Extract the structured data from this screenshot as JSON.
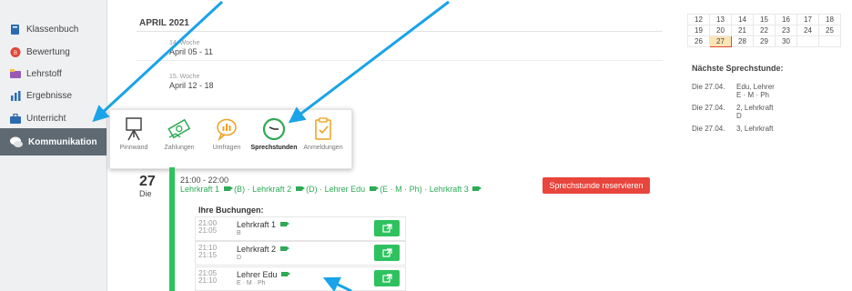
{
  "sidebar": {
    "items": [
      {
        "label": "Klassenbuch",
        "icon": "book-icon",
        "color": "#2b6cb0"
      },
      {
        "label": "Bewertung",
        "icon": "badge-icon",
        "color": "#e0453a"
      },
      {
        "label": "Lehrstoff",
        "icon": "folder-icon",
        "color": "#9b59b6"
      },
      {
        "label": "Ergebnisse",
        "icon": "bar-chart-icon",
        "color": "#2b6cb0"
      },
      {
        "label": "Unterricht",
        "icon": "briefcase-icon",
        "color": "#2b6cb0"
      },
      {
        "label": "Kommunikation",
        "icon": "chat-icon",
        "color": "#ffffff"
      }
    ]
  },
  "main": {
    "month": "APRIL 2021",
    "weeks": [
      {
        "label": "14. Woche",
        "range": "April 05 - 11"
      },
      {
        "label": "15. Woche",
        "range": "April 12 - 18"
      }
    ]
  },
  "popup": {
    "items": [
      {
        "label": "Pinnwand",
        "icon": "easel-icon"
      },
      {
        "label": "Zahlungen",
        "icon": "money-icon"
      },
      {
        "label": "Umfragen",
        "icon": "poll-icon"
      },
      {
        "label": "Sprechstunden",
        "icon": "clock-icon"
      },
      {
        "label": "Anmeldungen",
        "icon": "clipboard-check-icon"
      }
    ]
  },
  "event": {
    "day": "27",
    "weekday": "Die",
    "time": "21:00 - 22:00",
    "teachers": [
      {
        "name": "Lehrkraft 1",
        "sub": "(B)"
      },
      {
        "name": "Lehrkraft 2",
        "sub": "(D)"
      },
      {
        "name": "Lehrer Edu",
        "sub": "(E · M · Ph)"
      },
      {
        "name": "Lehrkraft 3",
        "sub": ""
      }
    ],
    "reserve_label": "Sprechstunde reservieren",
    "bookings_title": "Ihre Buchungen:",
    "bookings": [
      {
        "start": "21:00",
        "end": "21:05",
        "name": "Lehrkraft 1",
        "subject": "B"
      },
      {
        "start": "21:10",
        "end": "21:15",
        "name": "Lehrkraft 2",
        "subject": "D"
      },
      {
        "start": "21:05",
        "end": "21:10",
        "name": "Lehrer Edu",
        "subject": "E · M · Ph"
      }
    ]
  },
  "calendar": {
    "rows": [
      [
        "12",
        "13",
        "14",
        "15",
        "16",
        "17",
        "18"
      ],
      [
        "19",
        "20",
        "21",
        "22",
        "23",
        "24",
        "25"
      ],
      [
        "26",
        "27",
        "28",
        "29",
        "30",
        "",
        ""
      ]
    ],
    "today": "27"
  },
  "next": {
    "title": "Nächste Sprechstunde:",
    "items": [
      {
        "date": "Die 27.04.",
        "who": "Edu, Lehrer",
        "sub": "E · M · Ph"
      },
      {
        "date": "Die 27.04.",
        "who": "2, Lehrkraft",
        "sub": "D"
      },
      {
        "date": "Die 27.04.",
        "who": "3, Lehrkraft",
        "sub": ""
      }
    ]
  },
  "colors": {
    "accent_green": "#2ec25e",
    "reserve_red": "#e8453c",
    "arrow_blue": "#1aa3e8",
    "sidebar_active": "#5e6972"
  }
}
